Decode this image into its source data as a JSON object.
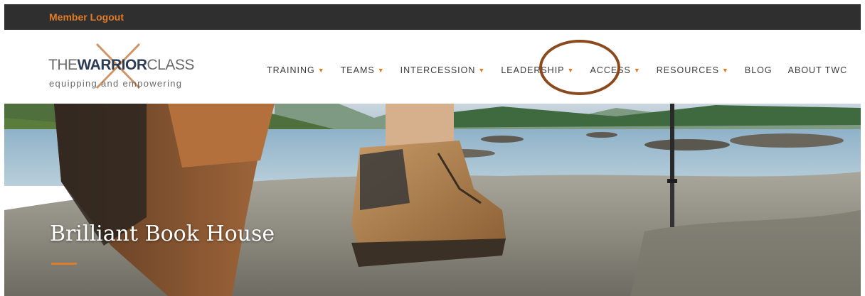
{
  "topbar": {
    "member_logout": "Member Logout"
  },
  "logo": {
    "the": "THE",
    "warrior": "WARRIOR",
    "class": "CLASS",
    "tagline": "equipping and empowering"
  },
  "nav": {
    "items": [
      {
        "label": "TRAINING",
        "dropdown": true
      },
      {
        "label": "TEAMS",
        "dropdown": true
      },
      {
        "label": "INTERCESSION",
        "dropdown": true
      },
      {
        "label": "LEADERSHIP",
        "dropdown": true
      },
      {
        "label": "ACCESS",
        "dropdown": true
      },
      {
        "label": "RESOURCES",
        "dropdown": true
      },
      {
        "label": "BLOG",
        "dropdown": false
      },
      {
        "label": "ABOUT TWC",
        "dropdown": false
      }
    ]
  },
  "hero": {
    "title": "Brilliant Book House"
  },
  "colors": {
    "accent": "#e07b27",
    "topbar": "#2f2f2f",
    "annotation": "#8b4a1d",
    "logo_x": "#c9824a"
  }
}
